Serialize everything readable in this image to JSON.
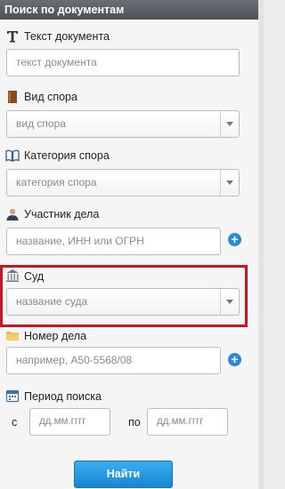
{
  "header": {
    "title": "Поиск по документам"
  },
  "doc_text": {
    "label": "Текст документа",
    "placeholder": "текст документа"
  },
  "dispute_type": {
    "label": "Вид спора",
    "value": "вид спора"
  },
  "dispute_category": {
    "label": "Категория спора",
    "value": "категория спора"
  },
  "participant": {
    "label": "Участник дела",
    "placeholder": "название, ИНН или ОГРН",
    "add": "+"
  },
  "court": {
    "label": "Суд",
    "value": "название суда"
  },
  "case_number": {
    "label": "Номер дела",
    "placeholder": "например, А50-5568/08",
    "add": "+"
  },
  "period": {
    "label": "Период поиска",
    "from_label": "с",
    "to_label": "по",
    "from_placeholder": "дд.мм.гггг",
    "to_placeholder": "дд.мм.гггг"
  },
  "find_button": "Найти",
  "colors": {
    "header": "#55595f",
    "accent": "#2b8ad6",
    "highlight": "#c8171e"
  }
}
